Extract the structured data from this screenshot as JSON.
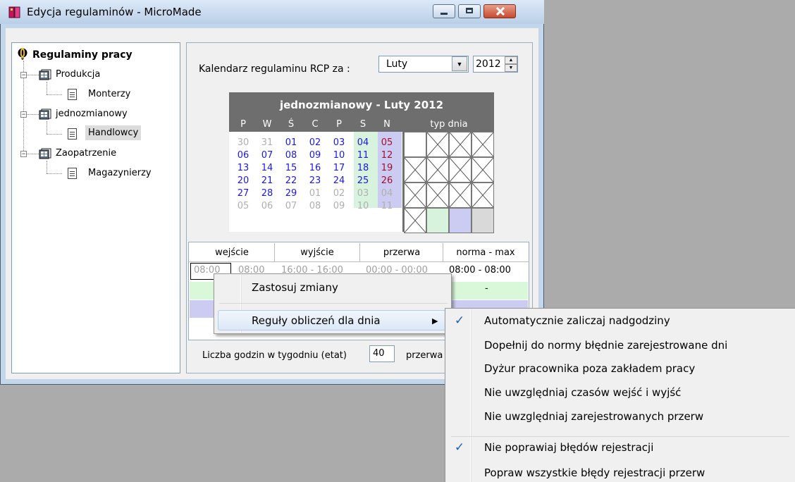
{
  "window": {
    "title": "Edycja regulaminów - MicroMade",
    "minimize_label": "",
    "maximize_label": "",
    "close_label": ""
  },
  "tree": {
    "root": "Regulaminy pracy",
    "groups": [
      {
        "label": "Produkcja",
        "children": [
          "Monterzy"
        ]
      },
      {
        "label": "jednozmianowy",
        "children": [
          "Handlowcy"
        ]
      },
      {
        "label": "Zaopatrzenie",
        "children": [
          "Magazynierzy"
        ]
      }
    ]
  },
  "calendar_bar": {
    "label": "Kalendarz regulaminu RCP  za :",
    "month": "Luty",
    "year": "2012"
  },
  "calendar": {
    "title": "jednozmianowy - Luty 2012",
    "day_headers": [
      "P",
      "W",
      "Ś",
      "C",
      "P",
      "S",
      "N"
    ],
    "typ_header": "typ dnia",
    "weeks": [
      [
        "30",
        "31",
        "01",
        "02",
        "03",
        "04",
        "05"
      ],
      [
        "06",
        "07",
        "08",
        "09",
        "10",
        "11",
        "12"
      ],
      [
        "13",
        "14",
        "15",
        "16",
        "17",
        "18",
        "19"
      ],
      [
        "20",
        "21",
        "22",
        "23",
        "24",
        "25",
        "26"
      ],
      [
        "27",
        "28",
        "29",
        "01",
        "02",
        "03",
        "04"
      ],
      [
        "05",
        "06",
        "07",
        "08",
        "09",
        "10",
        "11"
      ]
    ]
  },
  "hours_table": {
    "headers": [
      "wejście",
      "wyjście",
      "przerwa",
      "norma - max"
    ],
    "row1": {
      "wejscie": "08:00",
      "wejscie2": "08:00",
      "wyjscie": "16:00 - 16:00",
      "przerwa": "00:00 - 00:00",
      "norma": "08:00 - 08:00"
    },
    "row2_norma": "-"
  },
  "footer": {
    "etat_label": "Liczba godzin w tygodniu (etat)",
    "etat_value": "40",
    "przerwa_label": "przerwa"
  },
  "context_menu": {
    "items": [
      "Zastosuj zmiany",
      "Reguły obliczeń dla dnia"
    ]
  },
  "submenu": {
    "items": [
      {
        "label": "Automatycznie zaliczaj nadgodziny",
        "checked": true
      },
      {
        "label": "Dopełnij do normy błędnie zarejestrowane dni",
        "checked": false
      },
      {
        "label": "Dyżur pracownika poza zakładem pracy",
        "checked": false
      },
      {
        "label": "Nie uwzględniaj czasów wejść i wyjść",
        "checked": false
      },
      {
        "label": "Nie uwzględniaj zarejestrowanych przerw",
        "checked": false
      },
      {
        "label": "Nie poprawiaj błędów rejestracji",
        "checked": true
      },
      {
        "label": "Popraw wszystkie błędy rejestracji przerw",
        "checked": false
      }
    ],
    "check_glyph": "✓"
  },
  "colors": {
    "weekday_blue": "#1a1ae0",
    "sunday_red": "#a01030",
    "saturday_bg": "#d7f2dd",
    "sunday_bg": "#cccbf2",
    "header_gray": "#6e6e6e"
  }
}
